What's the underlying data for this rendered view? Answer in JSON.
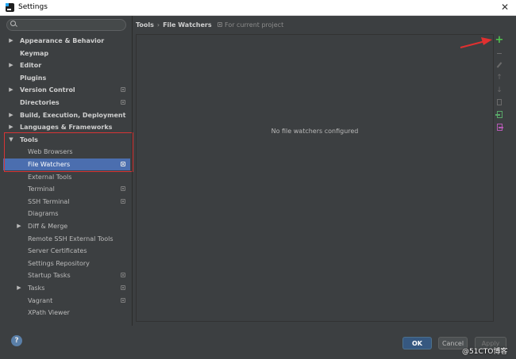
{
  "window": {
    "title": "Settings",
    "close_glyph": "✕"
  },
  "search": {
    "value": "",
    "placeholder": ""
  },
  "sidebar": {
    "items": [
      {
        "label": "Appearance & Behavior",
        "level": 0,
        "arrow": "▶",
        "bold": true,
        "scope": false,
        "selected": false
      },
      {
        "label": "Keymap",
        "level": 0,
        "arrow": "",
        "bold": true,
        "scope": false,
        "selected": false
      },
      {
        "label": "Editor",
        "level": 0,
        "arrow": "▶",
        "bold": true,
        "scope": false,
        "selected": false
      },
      {
        "label": "Plugins",
        "level": 0,
        "arrow": "",
        "bold": true,
        "scope": false,
        "selected": false
      },
      {
        "label": "Version Control",
        "level": 0,
        "arrow": "▶",
        "bold": true,
        "scope": true,
        "selected": false
      },
      {
        "label": "Directories",
        "level": 0,
        "arrow": "",
        "bold": true,
        "scope": true,
        "selected": false
      },
      {
        "label": "Build, Execution, Deployment",
        "level": 0,
        "arrow": "▶",
        "bold": true,
        "scope": false,
        "selected": false
      },
      {
        "label": "Languages & Frameworks",
        "level": 0,
        "arrow": "▶",
        "bold": true,
        "scope": false,
        "selected": false
      },
      {
        "label": "Tools",
        "level": 0,
        "arrow": "▼",
        "bold": true,
        "scope": false,
        "selected": false
      },
      {
        "label": "Web Browsers",
        "level": 1,
        "arrow": "",
        "bold": false,
        "scope": false,
        "selected": false
      },
      {
        "label": "File Watchers",
        "level": 1,
        "arrow": "",
        "bold": false,
        "scope": true,
        "selected": true
      },
      {
        "label": "External Tools",
        "level": 1,
        "arrow": "",
        "bold": false,
        "scope": false,
        "selected": false
      },
      {
        "label": "Terminal",
        "level": 1,
        "arrow": "",
        "bold": false,
        "scope": true,
        "selected": false
      },
      {
        "label": "SSH Terminal",
        "level": 1,
        "arrow": "",
        "bold": false,
        "scope": true,
        "selected": false
      },
      {
        "label": "Diagrams",
        "level": 1,
        "arrow": "",
        "bold": false,
        "scope": false,
        "selected": false
      },
      {
        "label": "Diff & Merge",
        "level": 1,
        "arrow": "▶",
        "bold": false,
        "scope": false,
        "selected": false
      },
      {
        "label": "Remote SSH External Tools",
        "level": 1,
        "arrow": "",
        "bold": false,
        "scope": false,
        "selected": false
      },
      {
        "label": "Server Certificates",
        "level": 1,
        "arrow": "",
        "bold": false,
        "scope": false,
        "selected": false
      },
      {
        "label": "Settings Repository",
        "level": 1,
        "arrow": "",
        "bold": false,
        "scope": false,
        "selected": false
      },
      {
        "label": "Startup Tasks",
        "level": 1,
        "arrow": "",
        "bold": false,
        "scope": true,
        "selected": false
      },
      {
        "label": "Tasks",
        "level": 1,
        "arrow": "▶",
        "bold": false,
        "scope": true,
        "selected": false
      },
      {
        "label": "Vagrant",
        "level": 1,
        "arrow": "",
        "bold": false,
        "scope": true,
        "selected": false
      },
      {
        "label": "XPath Viewer",
        "level": 1,
        "arrow": "",
        "bold": false,
        "scope": false,
        "selected": false
      }
    ]
  },
  "header": {
    "crumb_parent": "Tools",
    "crumb_separator": "›",
    "crumb_current": "File Watchers",
    "scope_note": "For current project"
  },
  "panel": {
    "empty_text": "No file watchers configured"
  },
  "toolbar": {
    "add_glyph": "+",
    "move_up_glyph": "↑",
    "move_down_glyph": "↓"
  },
  "footer": {
    "help_glyph": "?",
    "ok_label": "OK",
    "cancel_label": "Cancel",
    "apply_label": "Apply",
    "watermark": "@51CTO博客"
  },
  "colors": {
    "background": "#3c3f41",
    "selection": "#4b6eaf",
    "highlight_box": "#d73535",
    "add_green": "#4fc44f",
    "ok_blue": "#365880"
  }
}
